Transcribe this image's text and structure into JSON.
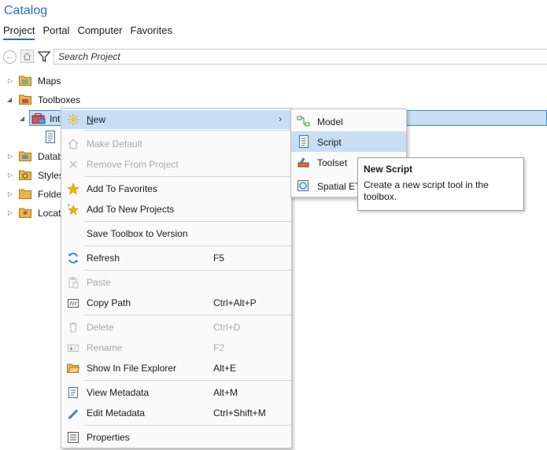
{
  "header": {
    "title": "Catalog",
    "tabs": [
      {
        "label": "Project",
        "active": true
      },
      {
        "label": "Portal"
      },
      {
        "label": "Computer"
      },
      {
        "label": "Favorites"
      }
    ]
  },
  "toolbar": {
    "back_icon": "back-arrow-icon",
    "search_placeholder": "Search Project"
  },
  "tree": {
    "items": [
      {
        "label": "Maps",
        "icon": "maps-folder-icon"
      },
      {
        "label": "Toolboxes",
        "icon": "toolboxes-folder-icon"
      },
      {
        "label": "Int",
        "icon": "toolbox-icon"
      },
      {
        "label": "Datab",
        "icon": "databases-folder-icon"
      },
      {
        "label": "Styles",
        "icon": "styles-folder-icon"
      },
      {
        "label": "Folde",
        "icon": "folders-icon"
      },
      {
        "label": "Locat",
        "icon": "locators-folder-icon"
      }
    ]
  },
  "context_menu": {
    "items": [
      {
        "label": "New",
        "mnemonic": "N",
        "rest": "ew",
        "shortcut": "",
        "disabled": false,
        "icon": "sparkle-icon"
      },
      {
        "label": "Make Default",
        "shortcut": "",
        "disabled": true,
        "icon": "home-icon"
      },
      {
        "label": "Remove From Project",
        "shortcut": "",
        "disabled": true,
        "icon": "close-icon"
      },
      {
        "label": "Add To Favorites",
        "shortcut": "",
        "disabled": false,
        "icon": "star-icon"
      },
      {
        "label": "Add To New Projects",
        "shortcut": "",
        "disabled": false,
        "icon": "star-sparkle-icon"
      },
      {
        "label": "Save Toolbox to Version",
        "shortcut": "",
        "disabled": false,
        "icon": ""
      },
      {
        "label": "Refresh",
        "shortcut": "F5",
        "disabled": false,
        "icon": "refresh-icon"
      },
      {
        "label": "Paste",
        "shortcut": "",
        "disabled": true,
        "icon": "paste-icon"
      },
      {
        "label": "Copy Path",
        "shortcut": "Ctrl+Alt+P",
        "disabled": false,
        "icon": "copy-path-icon"
      },
      {
        "label": "Delete",
        "shortcut": "Ctrl+D",
        "disabled": true,
        "icon": "trash-icon"
      },
      {
        "label": "Rename",
        "shortcut": "F2",
        "disabled": true,
        "icon": "rename-icon"
      },
      {
        "label": "Show In File Explorer",
        "shortcut": "Alt+E",
        "disabled": false,
        "icon": "folder-open-icon"
      },
      {
        "label": "View Metadata",
        "shortcut": "Alt+M",
        "disabled": false,
        "icon": "metadata-icon"
      },
      {
        "label": "Edit Metadata",
        "shortcut": "Ctrl+Shift+M",
        "disabled": false,
        "icon": "pencil-icon"
      },
      {
        "label": "Properties",
        "shortcut": "",
        "disabled": false,
        "icon": "properties-icon"
      }
    ]
  },
  "submenu": {
    "items": [
      {
        "label": "Model",
        "icon": "model-icon"
      },
      {
        "label": "Script",
        "icon": "script-icon"
      },
      {
        "label": "Toolset",
        "icon": "toolset-icon"
      },
      {
        "label": "Spatial ET",
        "icon": "spatial-etl-icon"
      }
    ]
  },
  "tooltip": {
    "title": "New Script",
    "body": "Create a new script tool in the toolbox."
  },
  "colors": {
    "accent": "#2b6cc4",
    "highlight": "#c7def5",
    "disabled": "#a8a8a8"
  }
}
